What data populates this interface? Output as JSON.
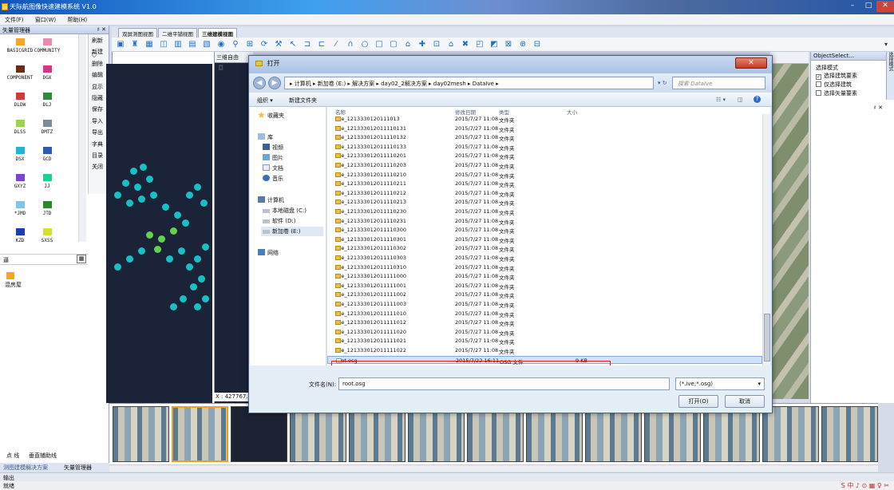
{
  "app": {
    "title": "天际航图像快速建模系统 V1.0",
    "menu": [
      "文件(F)",
      "窗口(W)",
      "帮助(H)"
    ]
  },
  "left_panel": {
    "title": "矢量管理器",
    "close": "♯ ✕",
    "layers": [
      {
        "name": "BASICGRID",
        "color": "#f5a623"
      },
      {
        "name": "COMMUNITY",
        "color": "#e98bb1"
      },
      {
        "name": "COMPONENT",
        "color": "#6b2b15"
      },
      {
        "name": "DGX",
        "color": "#d4368a"
      },
      {
        "name": "DLDW",
        "color": "#d33a3a"
      },
      {
        "name": "DLJ",
        "color": "#2c8c3c"
      },
      {
        "name": "DLSS",
        "color": "#9cd34a"
      },
      {
        "name": "DMTZ",
        "color": "#7a8b99"
      },
      {
        "name": "DSX",
        "color": "#1fb7d1"
      },
      {
        "name": "GCD",
        "color": "#2a5db2"
      },
      {
        "name": "GXYZ",
        "color": "#7a47c7"
      },
      {
        "name": "JJ",
        "color": "#1fcf9b"
      },
      {
        "name": "*JMD",
        "color": "#7fc6e8"
      },
      {
        "name": "JTD",
        "color": "#2a8a2a"
      },
      {
        "name": "KZD",
        "color": "#1a3fb3"
      },
      {
        "name": "SXSS",
        "color": "#d6e02c"
      }
    ],
    "side_buttons": [
      "刷新",
      "新建",
      "删除",
      "编辑",
      "显示",
      "隐藏",
      "保存",
      "导入",
      "导出",
      "字典",
      "目录",
      "关闭"
    ],
    "search_text": "逼",
    "group_label": "混房屋",
    "bottom_tabs": [
      "点 线",
      "垂直辅助线"
    ],
    "bottom_tabs2": [
      "测图建模解决方案",
      "矢量管理器"
    ]
  },
  "view_tabs": [
    "双屏测图视图",
    "二维平铺视图",
    "三维建模视图"
  ],
  "view3d_header": "三维自由",
  "coord": "X : 427767.",
  "dialog": {
    "title": "打开",
    "close": "✕",
    "address": "▸ 计算机 ▸ 新加卷 (E:) ▸ 解决方案 ▸ day02_2解决方案 ▸ day02mesh ▸ DataIve ▸",
    "search_placeholder": "搜索 DataIve",
    "commands": [
      "组织 ▾",
      "新建文件夹"
    ],
    "nav": {
      "favorites": "收藏夹",
      "libraries": "库",
      "lib_items": [
        "视频",
        "图片",
        "文档",
        "音乐"
      ],
      "computer": "计算机",
      "drives": [
        "本地磁盘 (C:)",
        "软件 (D:)",
        "新加卷 (E:)"
      ],
      "network": "网络"
    },
    "columns": [
      "名称",
      "修改日期",
      "类型",
      "大小"
    ],
    "files": [
      {
        "name": "Tile_1213330120111013",
        "date": "2015/7/27 11:08",
        "type": "文件夹",
        "size": ""
      },
      {
        "name": "Tile_121333012011110131",
        "date": "2015/7/27 11:08",
        "type": "文件夹",
        "size": ""
      },
      {
        "name": "Tile_121333012011110132",
        "date": "2015/7/27 11:08",
        "type": "文件夹",
        "size": ""
      },
      {
        "name": "Tile_121333012011110133",
        "date": "2015/7/27 11:08",
        "type": "文件夹",
        "size": ""
      },
      {
        "name": "Tile_121333012011110201",
        "date": "2015/7/27 11:08",
        "type": "文件夹",
        "size": ""
      },
      {
        "name": "Tile_121333012011110203",
        "date": "2015/7/27 11:08",
        "type": "文件夹",
        "size": ""
      },
      {
        "name": "Tile_121333012011110210",
        "date": "2015/7/27 11:08",
        "type": "文件夹",
        "size": ""
      },
      {
        "name": "Tile_121333012011110211",
        "date": "2015/7/27 11:08",
        "type": "文件夹",
        "size": ""
      },
      {
        "name": "Tile_121333012011110212",
        "date": "2015/7/27 11:08",
        "type": "文件夹",
        "size": ""
      },
      {
        "name": "Tile_121333012011110213",
        "date": "2015/7/27 11:08",
        "type": "文件夹",
        "size": ""
      },
      {
        "name": "Tile_121333012011110230",
        "date": "2015/7/27 11:08",
        "type": "文件夹",
        "size": ""
      },
      {
        "name": "Tile_121333012011110231",
        "date": "2015/7/27 11:08",
        "type": "文件夹",
        "size": ""
      },
      {
        "name": "Tile_121333012011110300",
        "date": "2015/7/27 11:08",
        "type": "文件夹",
        "size": ""
      },
      {
        "name": "Tile_121333012011110301",
        "date": "2015/7/27 11:08",
        "type": "文件夹",
        "size": ""
      },
      {
        "name": "Tile_121333012011110302",
        "date": "2015/7/27 11:08",
        "type": "文件夹",
        "size": ""
      },
      {
        "name": "Tile_121333012011110303",
        "date": "2015/7/27 11:08",
        "type": "文件夹",
        "size": ""
      },
      {
        "name": "Tile_121333012011110310",
        "date": "2015/7/27 11:08",
        "type": "文件夹",
        "size": ""
      },
      {
        "name": "Tile_121333012011111000",
        "date": "2015/7/27 11:08",
        "type": "文件夹",
        "size": ""
      },
      {
        "name": "Tile_121333012011111001",
        "date": "2015/7/27 11:08",
        "type": "文件夹",
        "size": ""
      },
      {
        "name": "Tile_121333012011111002",
        "date": "2015/7/27 11:08",
        "type": "文件夹",
        "size": ""
      },
      {
        "name": "Tile_121333012011111003",
        "date": "2015/7/27 11:08",
        "type": "文件夹",
        "size": ""
      },
      {
        "name": "Tile_121333012011111010",
        "date": "2015/7/27 11:08",
        "type": "文件夹",
        "size": ""
      },
      {
        "name": "Tile_121333012011111012",
        "date": "2015/7/27 11:08",
        "type": "文件夹",
        "size": ""
      },
      {
        "name": "Tile_121333012011111020",
        "date": "2015/7/27 11:08",
        "type": "文件夹",
        "size": ""
      },
      {
        "name": "Tile_121333012011111021",
        "date": "2015/7/27 11:08",
        "type": "文件夹",
        "size": ""
      },
      {
        "name": "Tile_121333012011111022",
        "date": "2015/7/27 11:08",
        "type": "文件夹",
        "size": ""
      },
      {
        "name": "root.osg",
        "date": "2015/7/22 16:11",
        "type": "OSG 文件",
        "size": "9 KB",
        "selected": true
      }
    ],
    "filename_label": "文件名(N):",
    "filename_value": "root.osg",
    "filetype": "(*.ive;*.osg)",
    "open_button": "打开(O)",
    "cancel_button": "取消"
  },
  "right_panel": {
    "title": "ObjectSelect...",
    "pin": "♯ ✕",
    "section": "选择模式",
    "options": [
      {
        "label": "选择建筑要素",
        "checked": true
      },
      {
        "label": "仅选择建筑",
        "checked": false
      },
      {
        "label": "选择矢量要素",
        "checked": false
      }
    ],
    "vtab": "选择模式"
  },
  "output_tab": "输出",
  "status_text": "就绪",
  "tray": "S 中 ♪ ⊙ ▦ ♀ ✂"
}
